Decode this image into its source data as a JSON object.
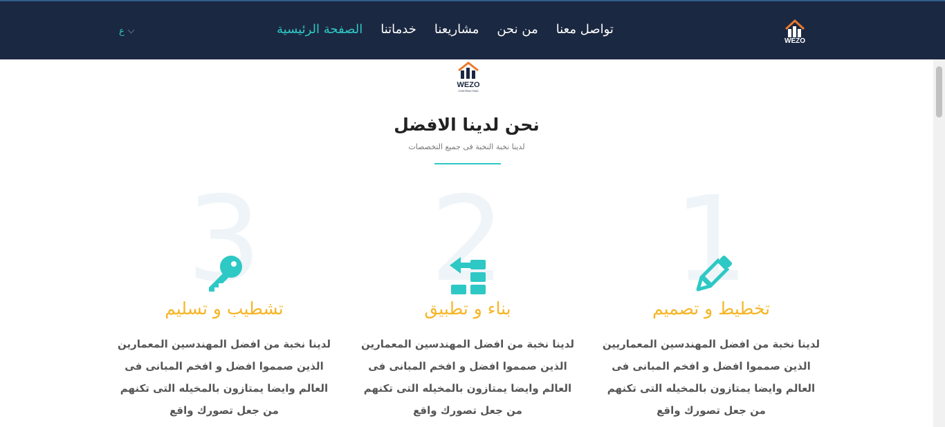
{
  "header": {
    "logo_text": "WEZO",
    "nav": [
      {
        "label": "الصفحة الرئيسية",
        "active": true
      },
      {
        "label": "خدماتنا",
        "active": false
      },
      {
        "label": "مشاريعنا",
        "active": false
      },
      {
        "label": "من نحن",
        "active": false
      },
      {
        "label": "تواصل معنا",
        "active": false
      }
    ],
    "language": "ع"
  },
  "brand": {
    "name": "WEZO",
    "tagline": "CONTRACTING"
  },
  "section": {
    "title": "نحن لدينا الافضل",
    "subtitle": "لدينا نخبة النخبة فى جميع التخصصات"
  },
  "features": [
    {
      "number": "1",
      "icon": "pencil-icon",
      "title": "تخطيط و تصميم",
      "text": "لدينا نخبة من افضل المهندسين المعماريين الذين صمموا افضل و افخم المبانى فى العالم وايضا يمتازون بالمخيله التى تكنهم من جعل تصورك واقع"
    },
    {
      "number": "2",
      "icon": "build-blocks-icon",
      "title": "بناء و تطبيق",
      "text": "لدينا نخبة من افضل المهندسين المعمارين الذين صمموا افضل و افخم المبانى فى العالم وايضا يمتازون بالمخيله التى تكنهم من جعل تصورك واقع"
    },
    {
      "number": "3",
      "icon": "key-icon",
      "title": "تشطيب و تسليم",
      "text": "لدينا نخبة من افضل المهندسين المعمارين الذين صمموا افضل و افخم المبانى فى العالم وايضا يمتازون بالمخيله التى تكنهم من جعل تصورك واقع"
    }
  ],
  "colors": {
    "navbar_bg": "#1b2841",
    "accent_teal": "#2ec8c5",
    "title_yellow": "#f6b526",
    "logo_orange": "#e8792b"
  }
}
